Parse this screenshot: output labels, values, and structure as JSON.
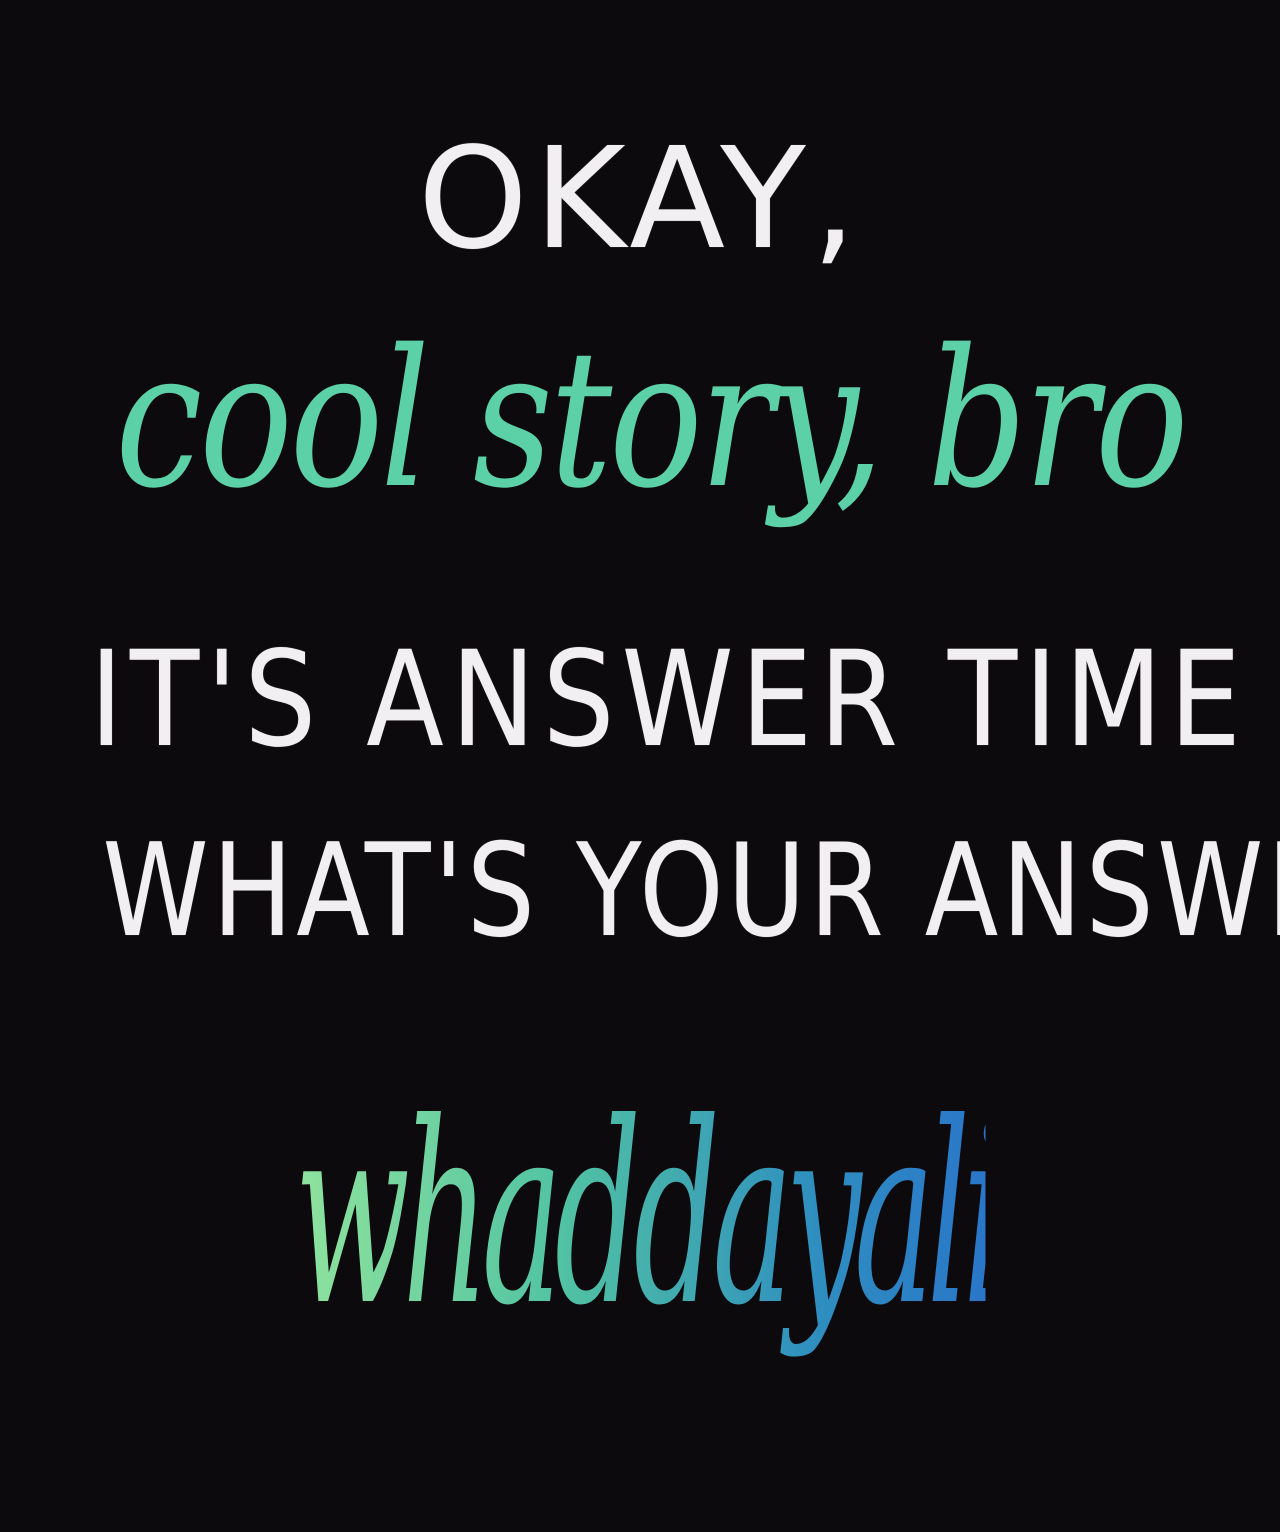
{
  "lines": {
    "okay": "OKAY,",
    "cool_story": "cool story, bro",
    "answer_time": "IT'S ANSWER TIME",
    "whats_your_answer": "WHAT'S YOUR ANSWER?",
    "final": "whaddayalikedafuk?"
  },
  "colors": {
    "background": "#0d0a0d",
    "print_text": "#f2eff2",
    "cool_story_text": "#5cd0a6",
    "final_gradient_start": "#8fe39d",
    "final_gradient_end": "#2a76c9"
  }
}
